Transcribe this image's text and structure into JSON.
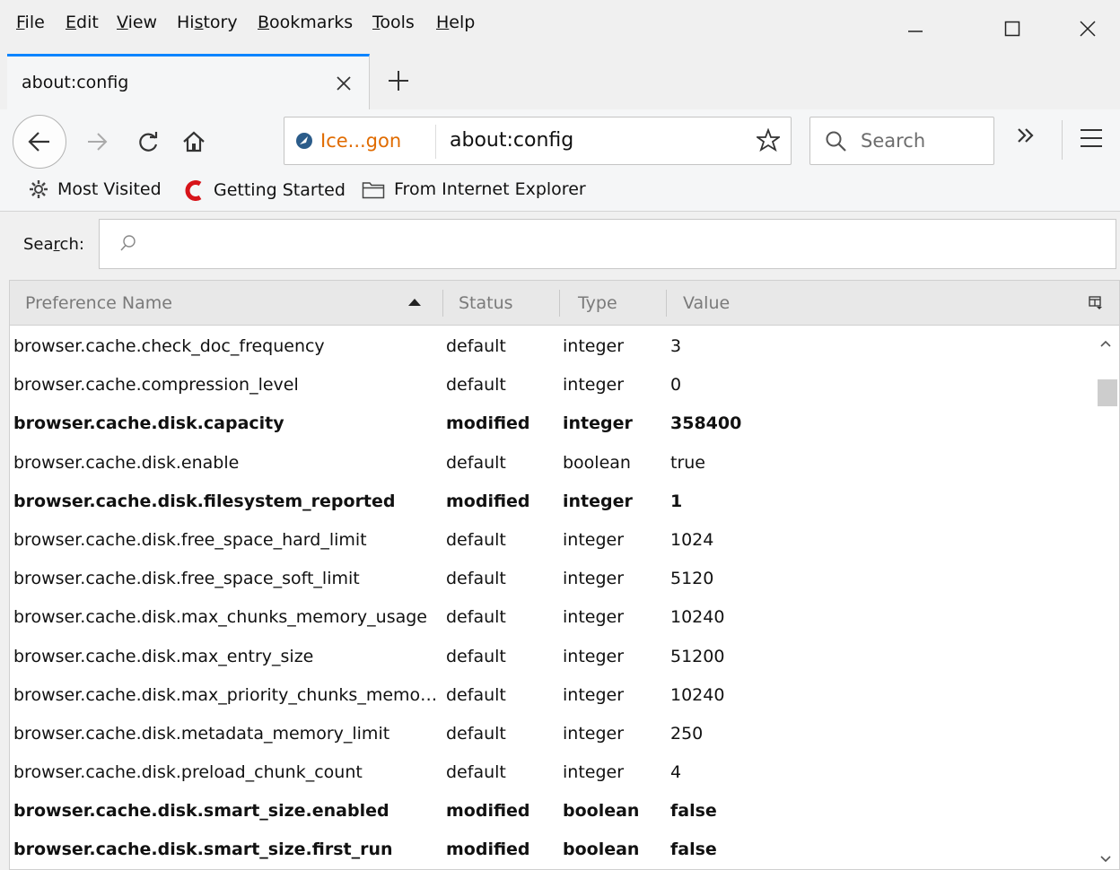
{
  "menubar": {
    "items": [
      {
        "accel": "F",
        "rest": "ile"
      },
      {
        "accel": "E",
        "rest": "dit"
      },
      {
        "accel": "V",
        "rest": "iew"
      },
      {
        "pre": "Hi",
        "accel": "s",
        "rest": "tory"
      },
      {
        "accel": "B",
        "rest": "ookmarks"
      },
      {
        "accel": "T",
        "rest": "ools"
      },
      {
        "accel": "H",
        "rest": "elp"
      }
    ]
  },
  "tab": {
    "title": "about:config"
  },
  "navbar": {
    "identity_label": "Ice...gon",
    "url": "about:config",
    "search_placeholder": "Search"
  },
  "bookmarks": {
    "most_visited": "Most Visited",
    "getting_started": "Getting Started",
    "from_ie": "From Internet Explorer"
  },
  "filter": {
    "label_pre": "Sea",
    "label_accel": "r",
    "label_post": "ch:"
  },
  "table": {
    "headers": {
      "name": "Preference Name",
      "status": "Status",
      "type": "Type",
      "value": "Value"
    },
    "rows": [
      {
        "name": "browser.cache.check_doc_frequency",
        "status": "default",
        "type": "integer",
        "value": "3",
        "modified": false
      },
      {
        "name": "browser.cache.compression_level",
        "status": "default",
        "type": "integer",
        "value": "0",
        "modified": false
      },
      {
        "name": "browser.cache.disk.capacity",
        "status": "modified",
        "type": "integer",
        "value": "358400",
        "modified": true
      },
      {
        "name": "browser.cache.disk.enable",
        "status": "default",
        "type": "boolean",
        "value": "true",
        "modified": false
      },
      {
        "name": "browser.cache.disk.filesystem_reported",
        "status": "modified",
        "type": "integer",
        "value": "1",
        "modified": true
      },
      {
        "name": "browser.cache.disk.free_space_hard_limit",
        "status": "default",
        "type": "integer",
        "value": "1024",
        "modified": false
      },
      {
        "name": "browser.cache.disk.free_space_soft_limit",
        "status": "default",
        "type": "integer",
        "value": "5120",
        "modified": false
      },
      {
        "name": "browser.cache.disk.max_chunks_memory_usage",
        "status": "default",
        "type": "integer",
        "value": "10240",
        "modified": false
      },
      {
        "name": "browser.cache.disk.max_entry_size",
        "status": "default",
        "type": "integer",
        "value": "51200",
        "modified": false
      },
      {
        "name": "browser.cache.disk.max_priority_chunks_memor...",
        "status": "default",
        "type": "integer",
        "value": "10240",
        "modified": false
      },
      {
        "name": "browser.cache.disk.metadata_memory_limit",
        "status": "default",
        "type": "integer",
        "value": "250",
        "modified": false
      },
      {
        "name": "browser.cache.disk.preload_chunk_count",
        "status": "default",
        "type": "integer",
        "value": "4",
        "modified": false
      },
      {
        "name": "browser.cache.disk.smart_size.enabled",
        "status": "modified",
        "type": "boolean",
        "value": "false",
        "modified": true
      },
      {
        "name": "browser.cache.disk.smart_size.first_run",
        "status": "modified",
        "type": "boolean",
        "value": "false",
        "modified": true
      }
    ]
  },
  "colors": {
    "tab_accent": "#0a84ff",
    "identity": "#e06b00",
    "getting_started_logo": "#d7141a"
  },
  "icons": [
    "back-arrow-icon",
    "forward-arrow-icon",
    "reload-icon",
    "home-icon",
    "site-identity-icon",
    "bookmark-star-icon",
    "search-icon",
    "overflow-chevron-icon",
    "hamburger-menu-icon",
    "gear-icon",
    "getting-started-logo-icon",
    "folder-icon",
    "filter-search-icon",
    "sort-ascending-icon",
    "column-picker-icon",
    "scroll-up-icon",
    "scroll-down-icon"
  ]
}
